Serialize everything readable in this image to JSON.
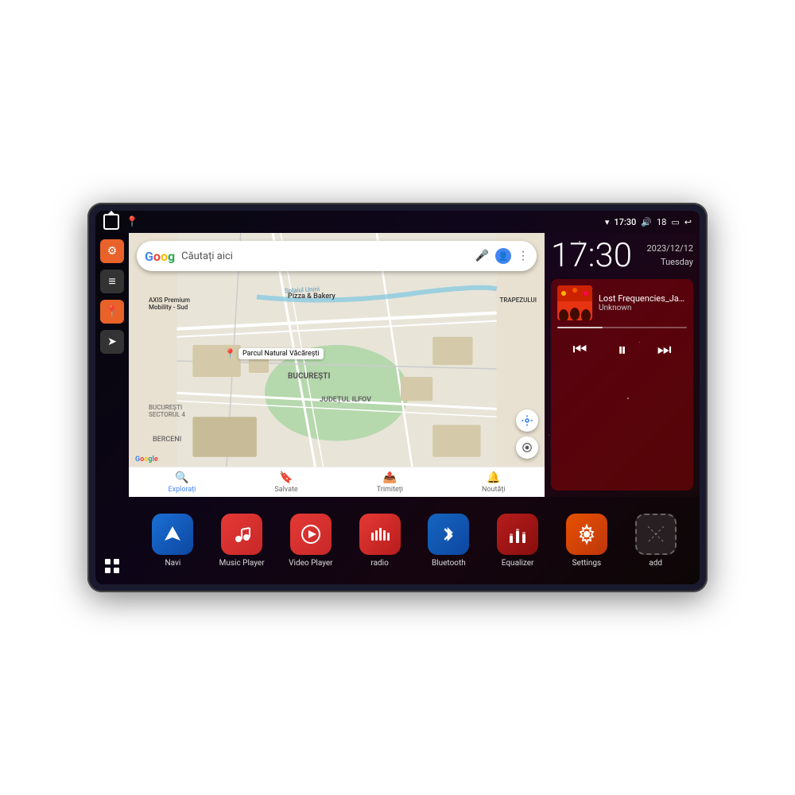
{
  "device": {
    "status_bar": {
      "wifi_icon": "▾",
      "time": "17:30",
      "volume_icon": "🔊",
      "battery_level": "18",
      "battery_icon": "🔋",
      "back_icon": "↩"
    },
    "clock": {
      "time": "17:30",
      "date": "2023/12/12",
      "day": "Tuesday"
    },
    "music": {
      "track": "Lost Frequencies_Janie...",
      "artist": "Unknown"
    },
    "map": {
      "search_placeholder": "Căutați aici",
      "labels": [
        "AXIS Premium\nMobility - Sud",
        "Pizza & Bakery",
        "TRAPEZULUI",
        "Parcul Natural Văcărești",
        "BUCUREȘTI",
        "SECTORUL 4",
        "JUDEȚUL ILFOV",
        "BERCENI"
      ],
      "nav_items": [
        {
          "label": "Explorați",
          "icon": "🔍"
        },
        {
          "label": "Salvate",
          "icon": "🔖"
        },
        {
          "label": "Trimiteți",
          "icon": "📤"
        },
        {
          "label": "Noutăți",
          "icon": "🔔"
        }
      ]
    },
    "sidebar": {
      "items": [
        {
          "icon": "⚙",
          "color": "orange",
          "name": "settings"
        },
        {
          "icon": "≡",
          "color": "dark",
          "name": "menu"
        },
        {
          "icon": "📍",
          "color": "orange",
          "name": "location"
        },
        {
          "icon": "➤",
          "color": "dark",
          "name": "navigate"
        }
      ]
    },
    "apps": [
      {
        "label": "Navi",
        "class": "app-navi",
        "icon": "➤",
        "name": "navi"
      },
      {
        "label": "Music Player",
        "class": "app-music",
        "icon": "♪",
        "name": "music-player"
      },
      {
        "label": "Video Player",
        "class": "app-video",
        "icon": "▶",
        "name": "video-player"
      },
      {
        "label": "radio",
        "class": "app-radio",
        "icon": "📻",
        "name": "radio"
      },
      {
        "label": "Bluetooth",
        "class": "app-bt",
        "icon": "⚡",
        "name": "bluetooth"
      },
      {
        "label": "Equalizer",
        "class": "app-eq",
        "icon": "📊",
        "name": "equalizer"
      },
      {
        "label": "Settings",
        "class": "app-settings",
        "icon": "⚙",
        "name": "settings-app"
      },
      {
        "label": "add",
        "class": "app-add",
        "icon": "＋",
        "name": "add-app"
      }
    ]
  }
}
